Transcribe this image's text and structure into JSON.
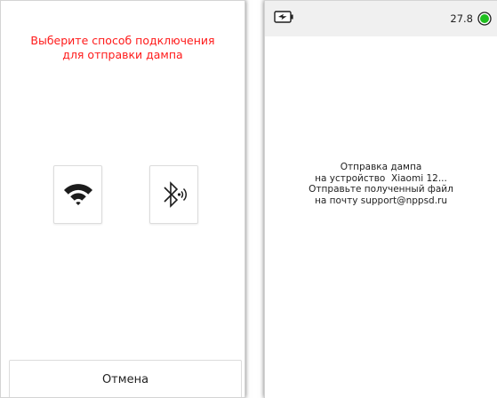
{
  "left_screen": {
    "heading_lines": [
      "Выберите способ подключения",
      "для отправки дампа"
    ],
    "options": [
      {
        "icon": "wifi-icon"
      },
      {
        "icon": "bluetooth-audio-icon"
      }
    ],
    "cancel_label": "Отмена"
  },
  "right_screen": {
    "status_bar": {
      "battery_icon": "battery-charging-icon",
      "value": "27.8",
      "status_icon": "green-status-indicator"
    },
    "message_lines": [
      "Отправка дампа",
      "на устройство  Xiaomi 12...",
      "Отправьте полученный файл",
      "на почту support@nppsd.ru"
    ]
  },
  "colors": {
    "heading": "#ff1a1a",
    "status_green": "#1fbf1f",
    "status_bar_bg": "#f0f0f0"
  }
}
